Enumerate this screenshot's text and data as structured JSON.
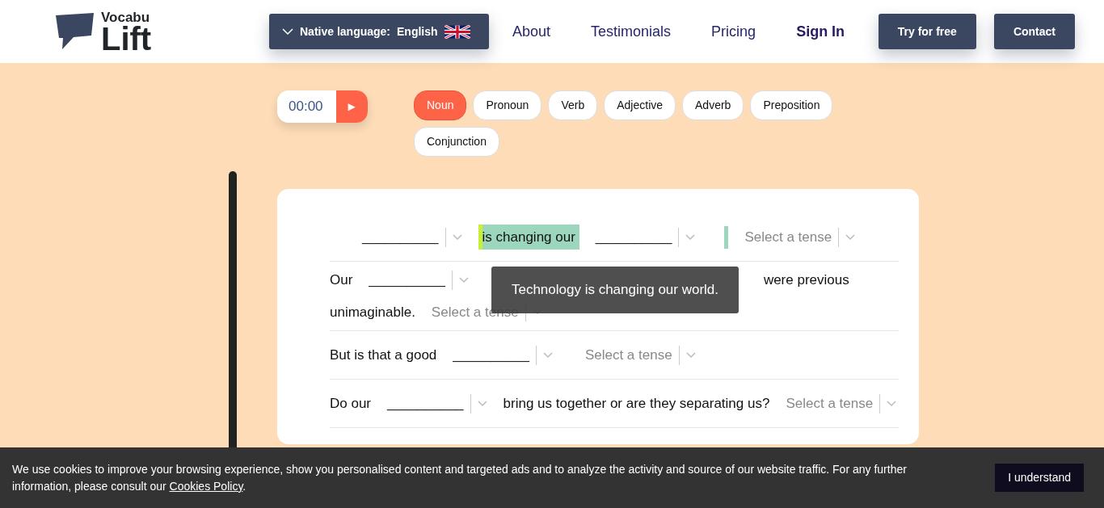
{
  "header": {
    "logo": {
      "line_1": "Vocabu",
      "line_2": "Lift"
    },
    "language": {
      "label": "Native language:",
      "value": "English"
    },
    "nav": [
      {
        "label": "About",
        "bold": false
      },
      {
        "label": "Testimonials",
        "bold": false
      },
      {
        "label": "Pricing",
        "bold": false
      },
      {
        "label": "Sign In",
        "bold": true
      }
    ],
    "buttons": [
      "Try for free",
      "Contact"
    ]
  },
  "timer": {
    "time": "00:00",
    "play": "►"
  },
  "word_classes": [
    {
      "label": "Noun",
      "selected": true
    },
    {
      "label": "Pronoun",
      "selected": false
    },
    {
      "label": "Verb",
      "selected": false
    },
    {
      "label": "Adjective",
      "selected": false
    },
    {
      "label": "Adverb",
      "selected": false
    },
    {
      "label": "Preposition",
      "selected": false
    },
    {
      "label": "Conjunction",
      "selected": false
    }
  ],
  "sentences": [
    {
      "items": [
        {
          "kind": "blank",
          "placeholder": "__________"
        },
        {
          "kind": "highlight",
          "text": "is changing our"
        },
        {
          "kind": "blank",
          "placeholder": "__________"
        },
        {
          "kind": "marker"
        },
        {
          "kind": "tense",
          "placeholder": "Select a tense"
        }
      ]
    },
    {
      "items": [
        {
          "kind": "text",
          "text": "Our"
        },
        {
          "kind": "blank",
          "placeholder": "__________"
        },
        {
          "kind": "gap"
        },
        {
          "kind": "text",
          "text": "were previous"
        },
        {
          "kind": "text",
          "text": "unimaginable."
        },
        {
          "kind": "tense",
          "placeholder": "Select a tense"
        }
      ]
    },
    {
      "items": [
        {
          "kind": "text",
          "text": "But is that a good"
        },
        {
          "kind": "blank",
          "placeholder": "__________"
        },
        {
          "kind": "tense",
          "placeholder": "Select a tense"
        }
      ]
    },
    {
      "items": [
        {
          "kind": "text",
          "text": "Do our"
        },
        {
          "kind": "blank",
          "placeholder": "__________"
        },
        {
          "kind": "text",
          "text": "bring us together or are they separating us?"
        },
        {
          "kind": "tense",
          "placeholder": "Select a tense"
        }
      ]
    }
  ],
  "tooltip": "Technology is changing our world.",
  "cookie_bar": {
    "message": "We use cookies to improve your browsing experience, show you personalised content and targeted ads and to analyze the activity and source of our website traffic. For any further information, please consult our ",
    "link": "Cookies Policy",
    "end": ".",
    "button": "I understand"
  }
}
